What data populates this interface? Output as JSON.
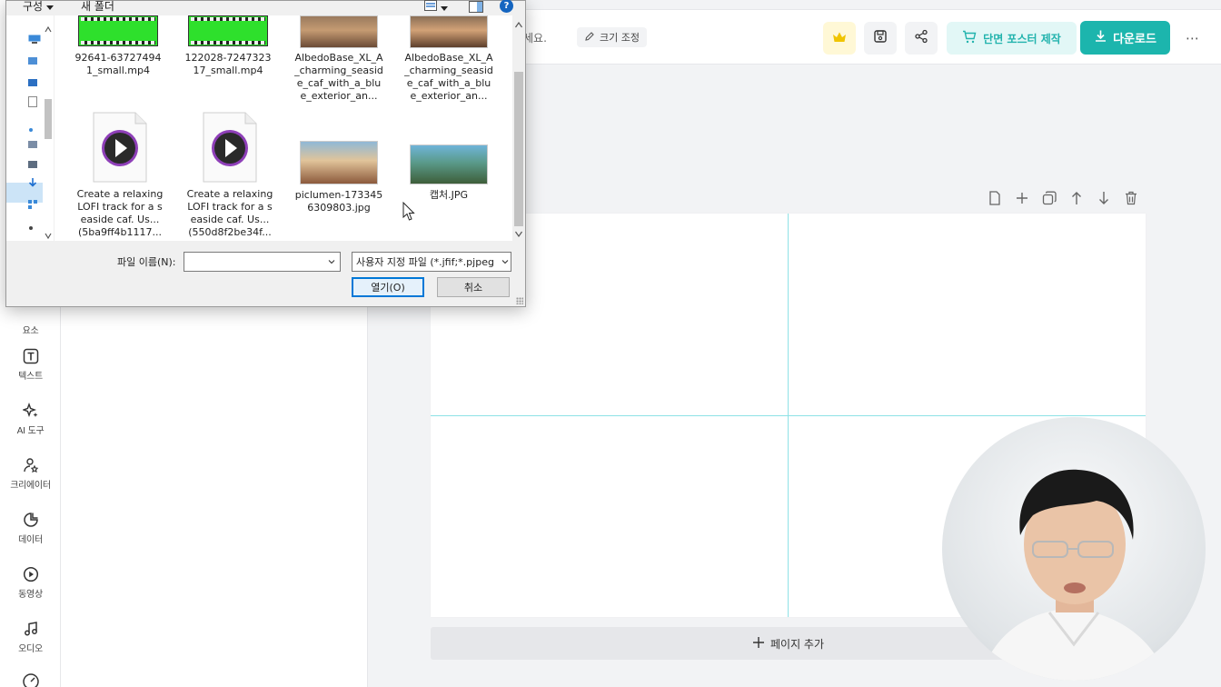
{
  "sidebar": {
    "items": [
      {
        "label": "요소",
        "icon": "elements-icon"
      },
      {
        "label": "텍스트",
        "icon": "text-icon"
      },
      {
        "label": "AI 도구",
        "icon": "ai-sparkle-icon"
      },
      {
        "label": "크리에이터",
        "icon": "creator-icon"
      },
      {
        "label": "데이터",
        "icon": "chart-icon"
      },
      {
        "label": "동영상",
        "icon": "video-play-icon"
      },
      {
        "label": "오디오",
        "icon": "music-note-icon"
      }
    ]
  },
  "topbar": {
    "hint_text": "세요.",
    "resize_label": "크기 조정",
    "poster_label": "단면 포스터 제작",
    "download_label": "다운로드",
    "more_label": "⋯"
  },
  "canvas": {
    "page_number": "-",
    "add_page_label": "페이지 추가"
  },
  "file_dialog": {
    "organize_label": "구성",
    "new_folder_label": "새 폴더",
    "help_label": "?",
    "files": [
      {
        "name": "92641-637274941_small.mp4",
        "type": "video"
      },
      {
        "name": "122028-724732317_small.mp4",
        "type": "video"
      },
      {
        "name": "AlbedoBase_XL_A_charming_seaside_caf_with_a_blue_exterior_an...",
        "type": "image"
      },
      {
        "name": "AlbedoBase_XL_A_charming_seaside_caf_with_a_blue_exterior_an...",
        "type": "image"
      },
      {
        "name": "Create a relaxing LOFI track for a seaside caf. Us... (5ba9ff4b1117...",
        "type": "audio"
      },
      {
        "name": "Create a relaxing LOFI track for a seaside caf. Us... (550d8f2be34f...",
        "type": "audio"
      },
      {
        "name": "piclumen-1733456309803.jpg",
        "type": "image"
      },
      {
        "name": "캡처.JPG",
        "type": "image"
      }
    ],
    "filename_label": "파일 이름(N):",
    "filename_value": "",
    "filetype_value": "사용자 지정 파일 (*.jfif;*.pjpeg",
    "open_label": "열기(O)",
    "cancel_label": "취소"
  },
  "colors": {
    "accent": "#1cb5ad",
    "accent_light": "#e2f7f6",
    "guide": "#8ee2e6",
    "dialog_focus": "#0078d7"
  }
}
